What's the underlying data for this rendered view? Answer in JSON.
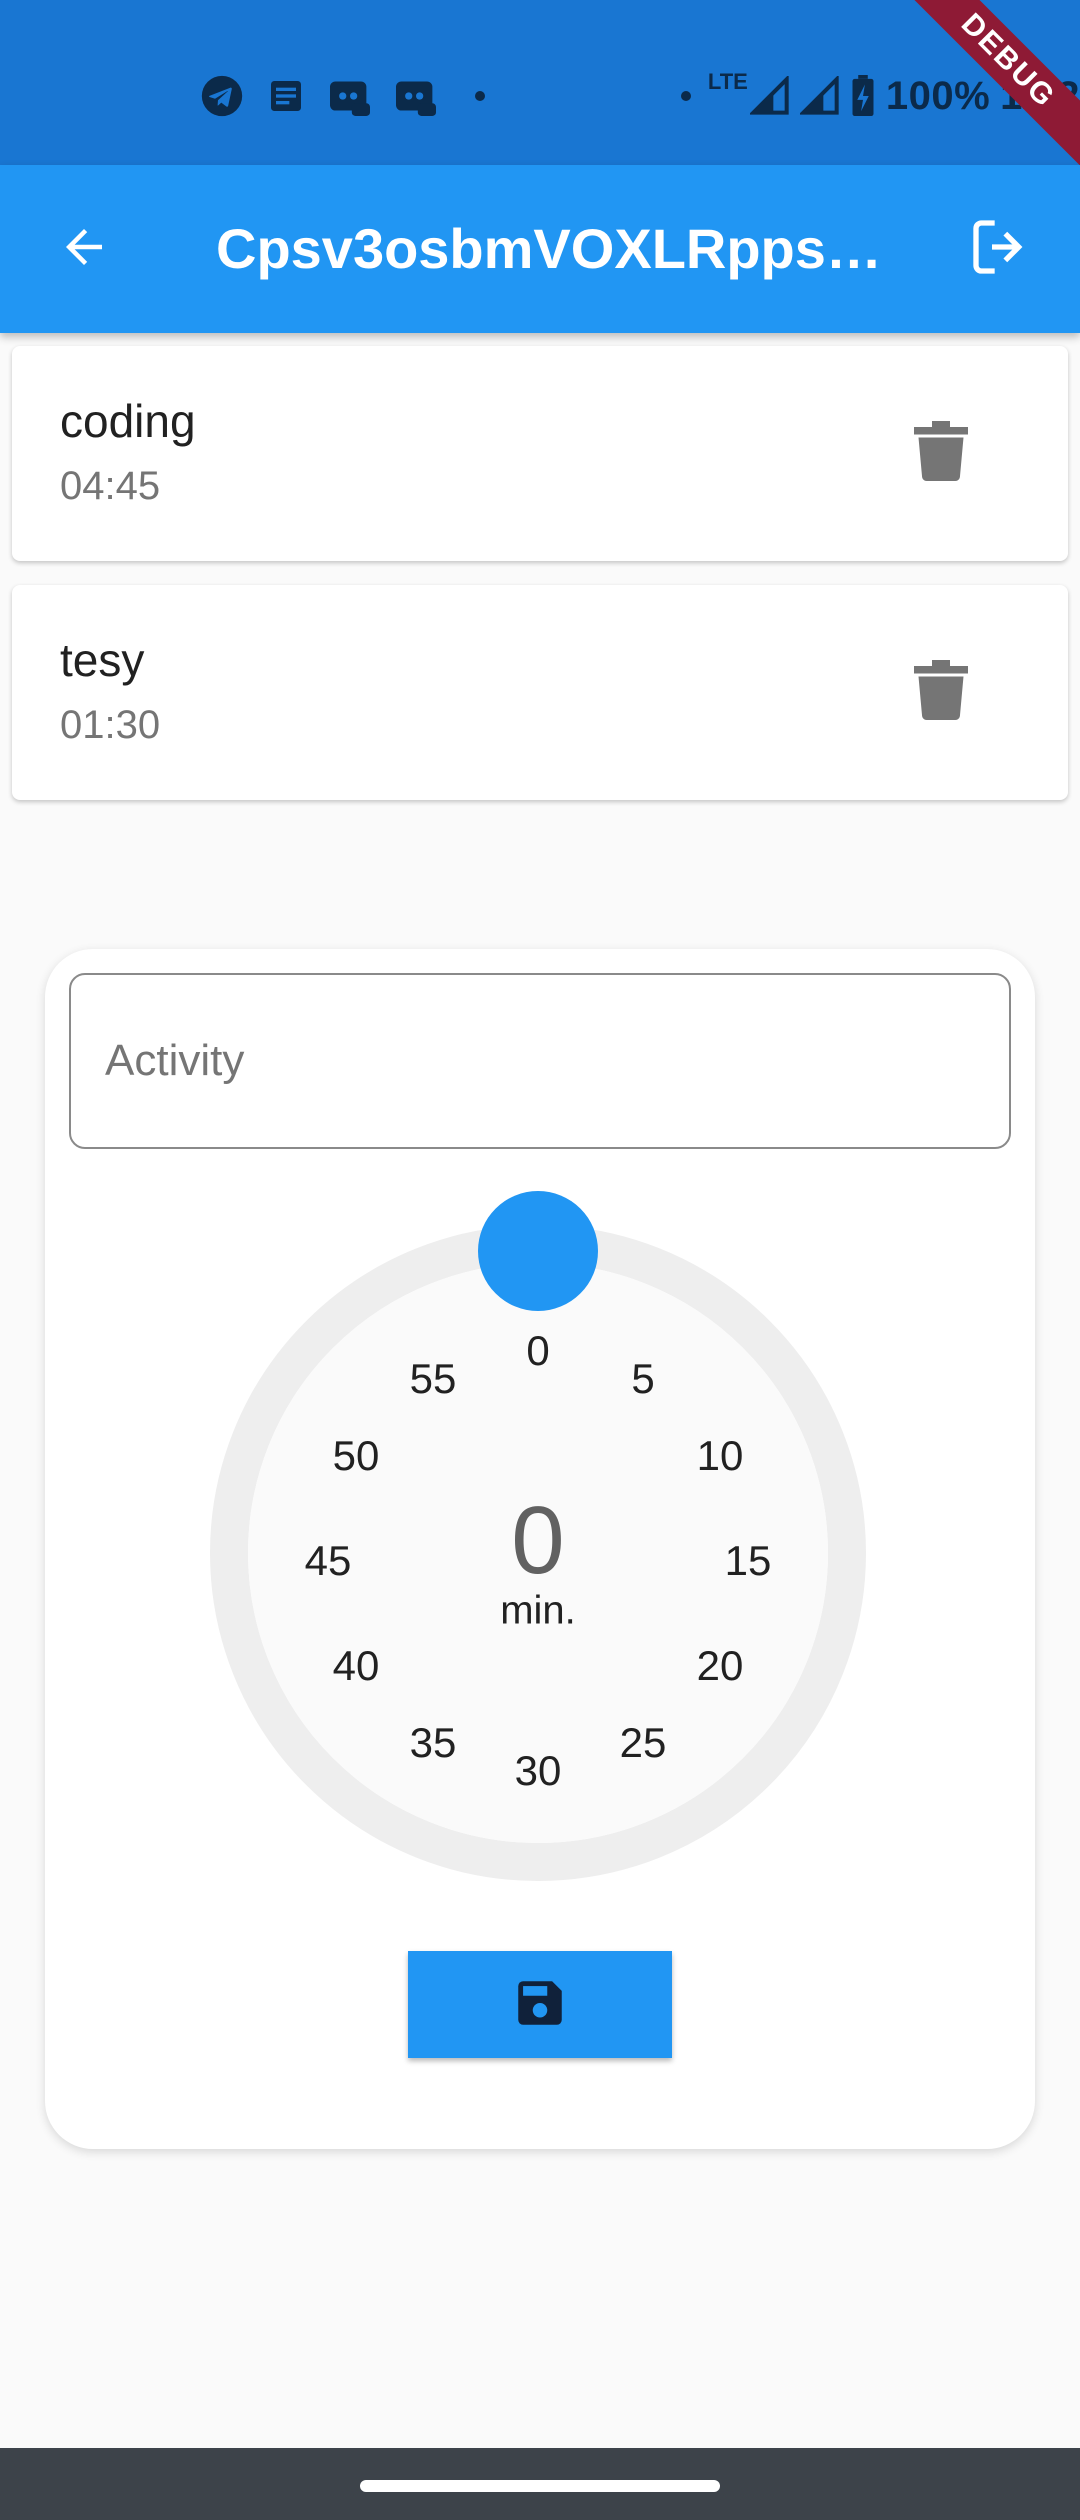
{
  "status_bar": {
    "network_type": "LTE",
    "battery": "100%",
    "clock": "11:2",
    "icons": [
      "telegram-icon",
      "notes-icon",
      "discord-icon",
      "discord-icon",
      "dot-icon",
      "dot-icon",
      "signal-icon",
      "signal-icon",
      "battery-charging-icon"
    ]
  },
  "debug_banner": "DEBUG",
  "app_bar": {
    "title": "Cpsv3osbmVOXLRppsj…",
    "back_icon": "arrow-back-icon",
    "logout_icon": "logout-icon",
    "color": "#2196F3"
  },
  "activities": [
    {
      "name": "coding",
      "duration": "04:45"
    },
    {
      "name": "tesy",
      "duration": "01:30"
    }
  ],
  "form": {
    "activity_placeholder": "Activity",
    "activity_value": ""
  },
  "timer": {
    "value": "0",
    "unit": "min.",
    "labels": [
      "0",
      "5",
      "10",
      "15",
      "20",
      "25",
      "30",
      "35",
      "40",
      "45",
      "50",
      "55"
    ]
  },
  "save_icon": "floppy-disk-icon",
  "colors": {
    "primary": "#2196F3",
    "status_bar": "#1976D2",
    "debug_ribbon": "#8E1A35"
  }
}
